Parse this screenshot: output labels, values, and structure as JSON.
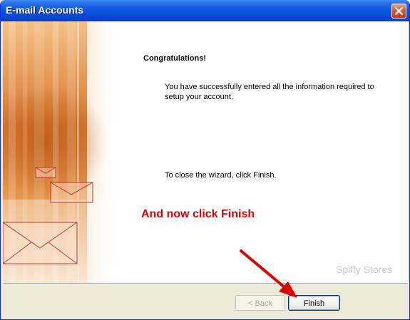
{
  "window": {
    "title": "E-mail Accounts",
    "close_icon": "close-icon"
  },
  "wizard": {
    "heading": "Congratulations!",
    "message": "You have successfully entered all the information required to setup your account.",
    "close_instruction": "To close the wizard, click Finish."
  },
  "overlay": {
    "annotation": "And now click Finish",
    "watermark": "Spiffy Stores",
    "annotation_color": "#E00000"
  },
  "buttons": {
    "back_label": "< Back",
    "finish_label": "Finish"
  },
  "colors": {
    "titlebar": "#0A55E0",
    "dialog_background": "#ECE9D8",
    "art_accent": "#E8A050"
  }
}
